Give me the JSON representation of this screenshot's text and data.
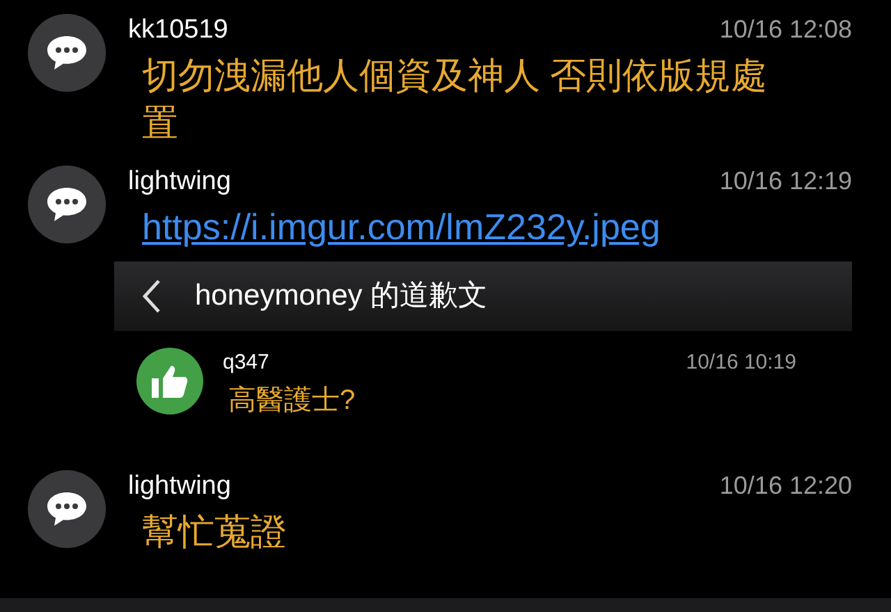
{
  "comments": [
    {
      "kind": "comment",
      "user": "kk10519",
      "time": "10/16 12:08",
      "text": "切勿洩漏他人個資及神人 否則依版規處置"
    },
    {
      "kind": "comment",
      "user": "lightwing",
      "time": "10/16 12:19",
      "link": "https://i.imgur.com/lmZ232y.jpeg",
      "embed": {
        "title": "honeymoney 的道歉文",
        "comment": {
          "kind": "push",
          "user": "q347",
          "time": "10/16 10:19",
          "text": "高醫護士?"
        }
      }
    },
    {
      "kind": "comment",
      "user": "lightwing",
      "time": "10/16 12:20",
      "text": "幫忙蒐證"
    }
  ]
}
